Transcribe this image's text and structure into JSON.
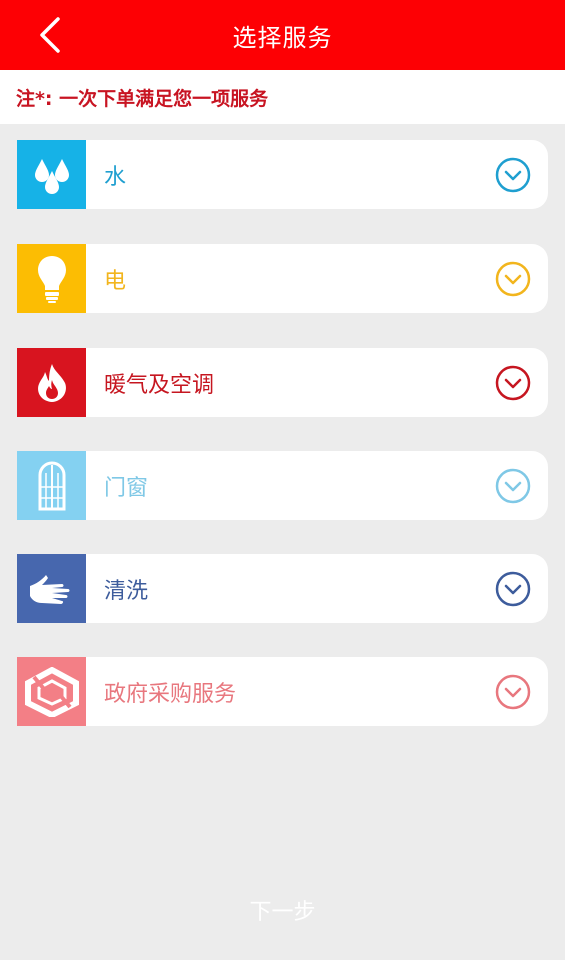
{
  "header": {
    "title": "选择服务",
    "back_icon": "chevron-left-icon"
  },
  "note": {
    "text": "注*: 一次下单满足您一项服务"
  },
  "services": [
    {
      "label": "水",
      "icon": "water-drops-icon",
      "color": "#16b2e7",
      "label_color": "#1f9fd0"
    },
    {
      "label": "电",
      "icon": "light-bulb-icon",
      "color": "#fcbd03",
      "label_color": "#f2b51d"
    },
    {
      "label": "暖气及空调",
      "icon": "flame-icon",
      "color": "#d8141f",
      "label_color": "#c61620"
    },
    {
      "label": "门窗",
      "icon": "window-icon",
      "color": "#84d1f1",
      "label_color": "#7fc8e6"
    },
    {
      "label": "清洗",
      "icon": "glove-icon",
      "color": "#4767ae",
      "label_color": "#3d5c9c"
    },
    {
      "label": "政府采购服务",
      "icon": "hexagon-logo-icon",
      "color": "#f37f86",
      "label_color": "#e8777e"
    }
  ],
  "footer": {
    "next_label": "下一步"
  }
}
